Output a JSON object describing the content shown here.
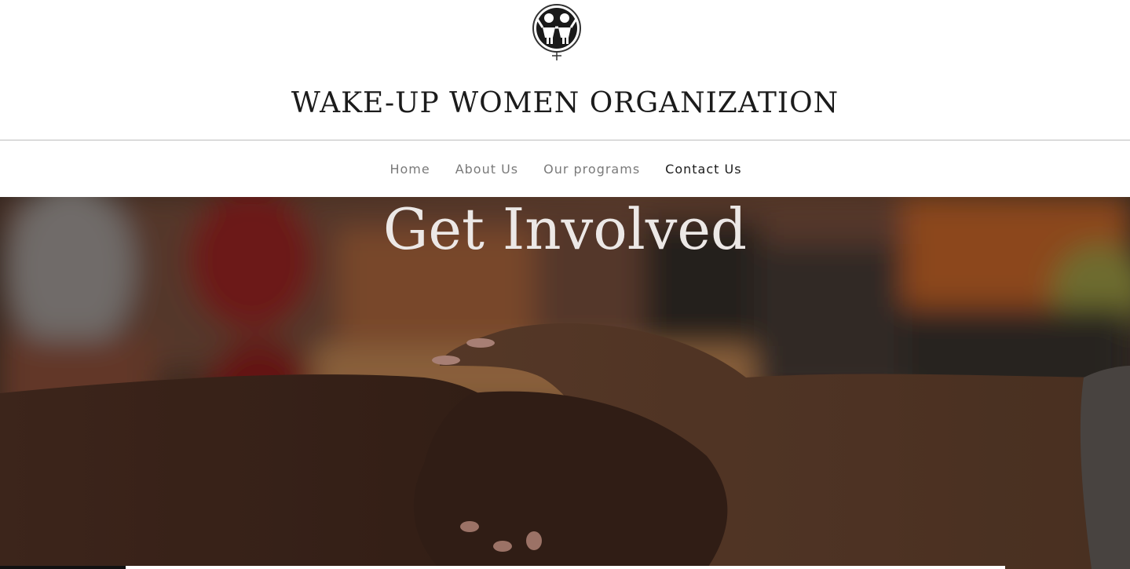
{
  "header": {
    "logo_icon": "women-organization-logo-icon",
    "site_title": "WAKE-UP WOMEN ORGANIZATION"
  },
  "nav": {
    "items": [
      {
        "label": "Home",
        "active": false
      },
      {
        "label": "About Us",
        "active": false
      },
      {
        "label": "Our programs",
        "active": false
      },
      {
        "label": "Contact Us",
        "active": true
      }
    ]
  },
  "hero": {
    "title": "Get Involved",
    "image": "handshake-image"
  },
  "colors": {
    "title_text": "#1b1b1b",
    "nav_inactive": "#7a7a7a",
    "nav_active": "#1b1b1b",
    "hero_title": "#ece8e6"
  }
}
